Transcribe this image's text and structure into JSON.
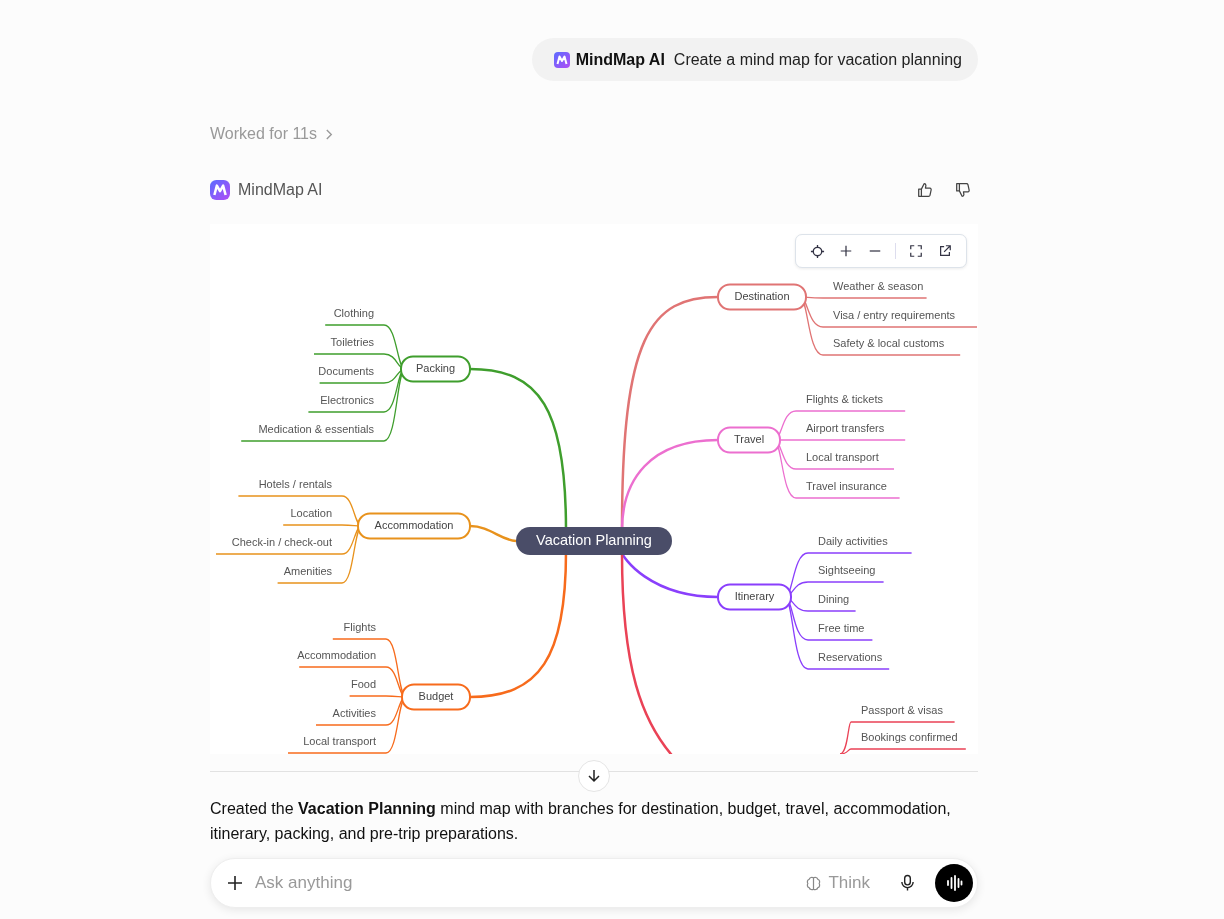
{
  "prompt": {
    "app_tag": "MindMap AI",
    "text": "Create a mind map for vacation planning"
  },
  "status": {
    "text": "Worked for 11s"
  },
  "response": {
    "author": "MindMap AI",
    "mind_map": {
      "root": "Vacation Planning",
      "branches": [
        {
          "label": "Destination",
          "color": "#e07474",
          "children": [
            "Weather & season",
            "Visa / entry requirements",
            "Safety & local customs"
          ]
        },
        {
          "label": "Travel",
          "color": "#ec6fcf",
          "children": [
            "Flights & tickets",
            "Airport transfers",
            "Local transport",
            "Travel insurance"
          ]
        },
        {
          "label": "Itinerary",
          "color": "#8a3ffc",
          "children": [
            "Daily activities",
            "Sightseeing",
            "Dining",
            "Free time",
            "Reservations"
          ]
        },
        {
          "color": "#ea4256",
          "children": [
            "Passport & visas",
            "Bookings confirmed"
          ]
        },
        {
          "label": "Packing",
          "color": "#3f9e2d",
          "children": [
            "Clothing",
            "Toiletries",
            "Documents",
            "Electronics",
            "Medication & essentials"
          ]
        },
        {
          "label": "Accommodation",
          "color": "#e8921c",
          "children": [
            "Hotels / rentals",
            "Location",
            "Check-in / check-out",
            "Amenities"
          ]
        },
        {
          "label": "Budget",
          "color": "#f76b1c",
          "children": [
            "Flights",
            "Accommodation",
            "Food",
            "Activities",
            "Local transport"
          ]
        }
      ]
    },
    "summary": "Created the **Vacation Planning** mind map with branches for destination, budget, travel, accommodation, itinerary, packing, and pre-trip preparations."
  },
  "composer": {
    "placeholder": "Ask anything",
    "think_label": "Think"
  }
}
